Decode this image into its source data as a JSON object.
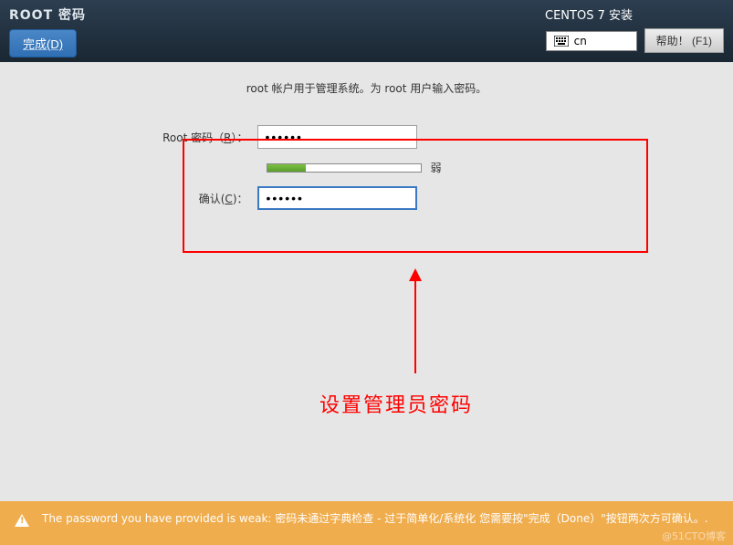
{
  "header": {
    "title": "ROOT 密码",
    "done_label": "完成(D)",
    "install_title": "CENTOS 7 安装",
    "lang_code": "cn",
    "help_label": "帮助！ (F1)"
  },
  "form": {
    "description": "root 帐户用于管理系统。为 root 用户输入密码。",
    "password_label_prefix": "Root 密码（",
    "password_label_key": "R",
    "password_label_suffix": "）：",
    "password_value": "••••••",
    "confirm_label_prefix": "确认(",
    "confirm_label_key": "C",
    "confirm_label_suffix": ")：",
    "confirm_value": "••••••",
    "strength_text": "弱",
    "strength_percent": 25
  },
  "annotation": {
    "text": "设置管理员密码"
  },
  "warning": {
    "text": "The password you have provided is weak: 密码未通过字典检查 - 过于简单化/系统化 您需要按\"完成（Done）\"按钮两次方可确认。."
  },
  "watermark": "@51CTO博客"
}
